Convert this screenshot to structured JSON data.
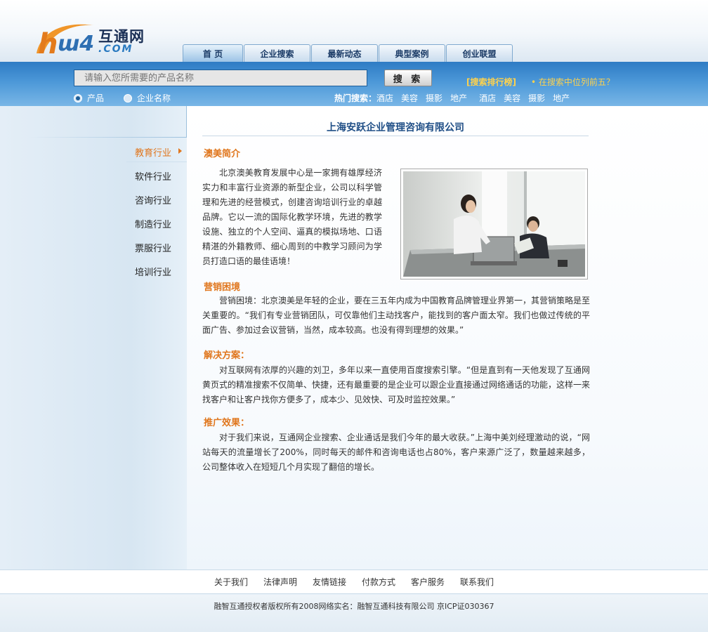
{
  "site": {
    "logo_cn": "互通网",
    "logo_domain": ".COM"
  },
  "nav": [
    {
      "label": "首 页"
    },
    {
      "label": "企业搜索"
    },
    {
      "label": "最新动态"
    },
    {
      "label": "典型案例"
    },
    {
      "label": "创业联盟"
    }
  ],
  "search": {
    "placeholder": "请输入您所需要的产品名称",
    "button_label": "搜 索",
    "rank_link": "[搜索排行榜]",
    "rank_hint": "• 在搜索中位列前五？",
    "radio_product": "产品",
    "radio_company": "企业名称"
  },
  "hot_search": {
    "label": "热门搜索：",
    "items": [
      "酒店",
      "美容",
      "摄影",
      "地产",
      "酒店",
      "美容",
      "摄影",
      "地产"
    ]
  },
  "sidebar": {
    "items": [
      {
        "label": "教育行业"
      },
      {
        "label": "软件行业"
      },
      {
        "label": "咨询行业"
      },
      {
        "label": "制造行业"
      },
      {
        "label": "票服行业"
      },
      {
        "label": "培训行业"
      }
    ]
  },
  "article": {
    "company": "上海安跃企业管理咨询有限公司",
    "intro_head": "澳美简介",
    "intro_text": "北京澳美教育发展中心是一家拥有雄厚经济实力和丰富行业资源的新型企业，公司以科学管理和先进的经营模式，创建咨询培训行业的卓越品牌。它以一流的国际化教学环境，先进的教学设施、独立的个人空间、逼真的模拟场地、口语精湛的外籍教师、细心周到的中教学习顾问为学员打造口语的最佳语境！",
    "marketing_head": "营销困境",
    "marketing_text": "营销困境：北京澳美是年轻的企业，要在三五年内成为中国教育品牌管理业界第一，其营销策略是至关重要的。“我们有专业营销团队，可仅靠他们主动找客户，能找到的客户面太窄。我们也做过传统的平面广告、参加过会议营销，当然，成本较高。也没有得到理想的效果。”",
    "solution_head": "解决方案：",
    "solution_text": "对互联网有浓厚的兴趣的刘卫，多年以来一直使用百度搜索引擎。“但是直到有一天他发现了互通网黄页式的精准搜索不仅简单、快捷，还有最重要的是企业可以跟企业直接通过网络通话的功能，这样一来找客户和让客户找你方便多了，成本少、见效快、可及时监控效果。”",
    "effect_head": "推广效果：",
    "effect_text": "对于我们来说，互通网企业搜索、企业通话是我们今年的最大收获。”上海中美刘经理激动的说，“网站每天的流量增长了200%，同时每天的邮件和咨询电话也占80%，客户来源广泛了，数量越来越多，公司整体收入在短短几个月实现了翻倍的增长。"
  },
  "footer": {
    "links": [
      "关于我们",
      "法律声明",
      "友情链接",
      "付款方式",
      "客户服务",
      "联系我们"
    ],
    "copyright": "融智互通授权者版权所有2008网络实名：融智互通科技有限公司 京ICP证030367"
  },
  "colors": {
    "accent_orange": "#e0761d",
    "nav_blue": "#1f4e86",
    "bar_blue": "#3d8ad0",
    "rank_yellow": "#ffd24d"
  }
}
